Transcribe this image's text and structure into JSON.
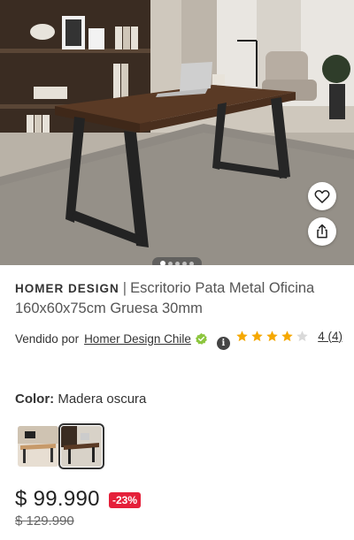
{
  "product": {
    "brand": "HOMER DESIGN",
    "separator": "|",
    "name": "Escritorio Pata Metal Oficina 160x60x75cm Gruesa 30mm"
  },
  "gallery": {
    "image_count": 5,
    "active_index": 0,
    "favorite_icon": "heart-icon",
    "share_icon": "share-icon"
  },
  "seller": {
    "label": "Vendido por",
    "name": "Homer Design Chile",
    "verified_icon": "verified-badge-icon",
    "info_icon_text": "i"
  },
  "rating": {
    "value": 4,
    "max": 5,
    "count_label": "4 (4)",
    "star_color": "#f5a800",
    "empty_star_color": "#d9d9d9"
  },
  "color": {
    "label": "Color:",
    "selected": "Madera oscura",
    "options": [
      "light-wood-thumbnail",
      "dark-wood-thumbnail"
    ]
  },
  "price": {
    "current": "$ 99.990",
    "discount": "-23%",
    "original": "$ 129.990",
    "discount_color": "#e5203a"
  }
}
